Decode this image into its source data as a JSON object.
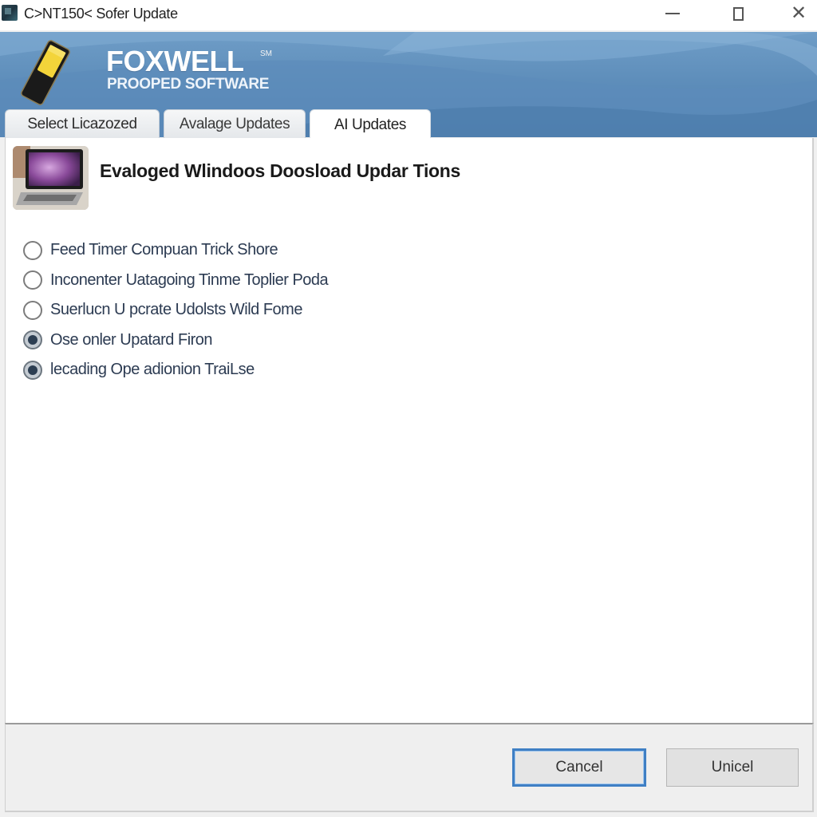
{
  "window": {
    "title": "C>NT150< Sofer Update",
    "icon": "app-icon",
    "controls": {
      "minimize": "minimize-icon",
      "maximize": "maximize-icon",
      "close": "close-icon",
      "close_glyph": "✕"
    }
  },
  "banner": {
    "brand": "FOXWELL",
    "trademark": "SM",
    "subtitle": "PROOPED SOFTWARE",
    "logo_icon": "scanner-device-icon",
    "colors": {
      "background": "#5b8bb8",
      "device_screen": "#f3d43a"
    }
  },
  "tabs": [
    {
      "label": "Select  Licazozed",
      "active": false
    },
    {
      "label": "Avalage Updates",
      "active": false
    },
    {
      "label": "AI Updates",
      "active": true
    }
  ],
  "content": {
    "header_image": "laptop-image",
    "title": "Evaloged Wlindoos Doosload Updar Tions",
    "options": [
      {
        "label": "Feed Timer Compuan Trick Shore",
        "checked": false
      },
      {
        "label": "Inconenter Uatagoing Tinme Toplier Poda",
        "checked": false
      },
      {
        "label": "Suerlucn U pcrate Udolsts Wild Fome",
        "checked": false
      },
      {
        "label": "Ose onler Upatard Firon",
        "checked": true
      },
      {
        "label": "lecading Ope adionion TraiLse",
        "checked": true
      }
    ]
  },
  "footer": {
    "buttons": [
      {
        "label": "Cancel",
        "focused": true
      },
      {
        "label": "Unicel",
        "focused": false
      }
    ],
    "focus_color": "#3f7fc4"
  }
}
